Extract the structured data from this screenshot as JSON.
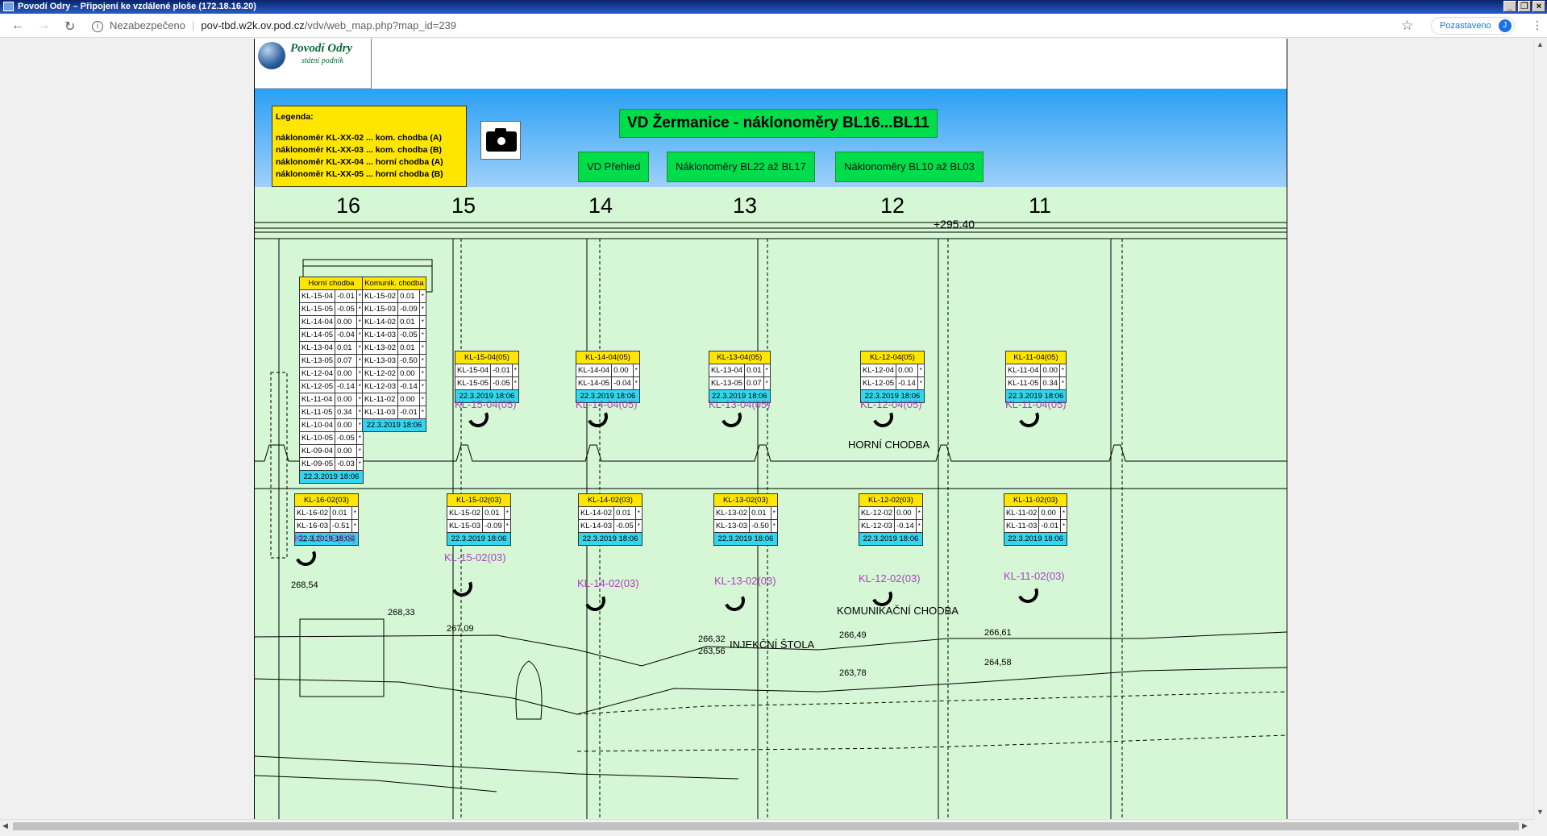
{
  "window": {
    "title": "Povodí Odry – Připojení ke vzdálené ploše (172.18.16.20)"
  },
  "browser": {
    "security_label": "Nezabezpečeno",
    "url_host": "pov-tbd.w2k.ov.pod.cz",
    "url_path": "/vdv/web_map.php?map_id=239",
    "profile_status": "Pozastaveno",
    "profile_initial": "J"
  },
  "logo": {
    "name": "Povodí Odry",
    "subtitle": "státní podnik"
  },
  "legend": {
    "title": "Legenda:",
    "items": [
      "náklonoměr KL-XX-02 ... kom. chodba (A)",
      "náklonoměr KL-XX-03 ... kom. chodba (B)",
      "náklonoměr KL-XX-04 ... horní chodba (A)",
      "náklonoměr KL-XX-05 ... horní chodba (B)"
    ]
  },
  "header": {
    "title": "VD Žermanice - náklonoměry BL16...BL11",
    "nav": [
      "VD Přehled",
      "Náklonoměry BL22 až BL17",
      "Náklonoměry BL10 až BL03"
    ]
  },
  "blocks": [
    "16",
    "15",
    "14",
    "13",
    "12",
    "11"
  ],
  "crest_elevation": "+295.40",
  "labels": {
    "upper": "HORNÍ CHODBA",
    "comm": "KOMUNIKAČNÍ CHODBA",
    "inj": "INJEKČNÍ ŠTOLA"
  },
  "elevations": [
    "268,54",
    "268,33",
    "267,09",
    "266,32",
    "263,56",
    "266,49",
    "263,78",
    "266,61",
    "264,58"
  ],
  "summary_upper": {
    "header": "Horní chodba",
    "rows": [
      [
        "KL-15-04",
        "-0.01"
      ],
      [
        "KL-15-05",
        "-0.05"
      ],
      [
        "KL-14-04",
        "0.00"
      ],
      [
        "KL-14-05",
        "-0.04"
      ],
      [
        "KL-13-04",
        "0.01"
      ],
      [
        "KL-13-05",
        "0.07"
      ],
      [
        "KL-12-04",
        "0.00"
      ],
      [
        "KL-12-05",
        "-0.14"
      ],
      [
        "KL-11-04",
        "0.00"
      ],
      [
        "KL-11-05",
        "0.34"
      ],
      [
        "KL-10-04",
        "0.00"
      ],
      [
        "KL-10-05",
        "-0.05"
      ],
      [
        "KL-09-04",
        "0.00"
      ],
      [
        "KL-09-05",
        "-0.03"
      ]
    ],
    "date": "22.3.2019 18:06"
  },
  "summary_comm": {
    "header": "Komunik. chodba",
    "rows": [
      [
        "KL-15-02",
        "0.01"
      ],
      [
        "KL-15-03",
        "-0.09"
      ],
      [
        "KL-14-02",
        "0.01"
      ],
      [
        "KL-14-03",
        "-0.05"
      ],
      [
        "KL-13-02",
        "0.01"
      ],
      [
        "KL-13-03",
        "-0.50"
      ],
      [
        "KL-12-02",
        "0.00"
      ],
      [
        "KL-12-03",
        "-0.14"
      ],
      [
        "KL-11-02",
        "0.00"
      ],
      [
        "KL-11-03",
        "-0.01"
      ]
    ],
    "date": "22.3.2019 18:06"
  },
  "upper_sensors": [
    {
      "header": "KL-15-04(05)",
      "rows": [
        [
          "KL-15-04",
          "-0.01"
        ],
        [
          "KL-15-05",
          "-0.05"
        ]
      ],
      "date": "22.3.2019 18:06",
      "label": "KL-15-04(05)"
    },
    {
      "header": "KL-14-04(05)",
      "rows": [
        [
          "KL-14-04",
          "0.00"
        ],
        [
          "KL-14-05",
          "-0.04"
        ]
      ],
      "date": "22.3.2019 18:06",
      "label": "KL-14-04(05)"
    },
    {
      "header": "KL-13-04(05)",
      "rows": [
        [
          "KL-13-04",
          "0.01"
        ],
        [
          "KL-13-05",
          "0.07"
        ]
      ],
      "date": "22.3.2019 18:06",
      "label": "KL-13-04(05)"
    },
    {
      "header": "KL-12-04(05)",
      "rows": [
        [
          "KL-12-04",
          "0.00"
        ],
        [
          "KL-12-05",
          "-0.14"
        ]
      ],
      "date": "22.3.2019 18:06",
      "label": "KL-12-04(05)"
    },
    {
      "header": "KL-11-04(05)",
      "rows": [
        [
          "KL-11-04",
          "0.00"
        ],
        [
          "KL-11-05",
          "0.34"
        ]
      ],
      "date": "22.3.2019 18:06",
      "label": "KL-11-04(05)"
    }
  ],
  "comm_sensors": [
    {
      "header": "KL-16-02(03)",
      "rows": [
        [
          "KL-16-02",
          "0.01"
        ],
        [
          "KL-16-03",
          "-0.51"
        ]
      ],
      "date": "22.3.2019 18:06",
      "label": "KL-16-02(03)"
    },
    {
      "header": "KL-15-02(03)",
      "rows": [
        [
          "KL-15-02",
          "0.01"
        ],
        [
          "KL-15-03",
          "-0.09"
        ]
      ],
      "date": "22.3.2019 18:06",
      "label": "KL-15-02(03)"
    },
    {
      "header": "KL-14-02(03)",
      "rows": [
        [
          "KL-14-02",
          "0.01"
        ],
        [
          "KL-14-03",
          "-0.05"
        ]
      ],
      "date": "22.3.2019 18:06",
      "label": "KL-14-02(03)"
    },
    {
      "header": "KL-13-02(03)",
      "rows": [
        [
          "KL-13-02",
          "0.01"
        ],
        [
          "KL-13-03",
          "-0.50"
        ]
      ],
      "date": "22.3.2019 18:06",
      "label": "KL-13-02(03)"
    },
    {
      "header": "KL-12-02(03)",
      "rows": [
        [
          "KL-12-02",
          "0.00"
        ],
        [
          "KL-12-03",
          "-0.14"
        ]
      ],
      "date": "22.3.2019 18:06",
      "label": "KL-12-02(03)"
    },
    {
      "header": "KL-11-02(03)",
      "rows": [
        [
          "KL-11-02",
          "0.00"
        ],
        [
          "KL-11-03",
          "-0.01"
        ]
      ],
      "date": "22.3.2019 18:06",
      "label": "KL-11-02(03)"
    }
  ],
  "status_mark": "*"
}
